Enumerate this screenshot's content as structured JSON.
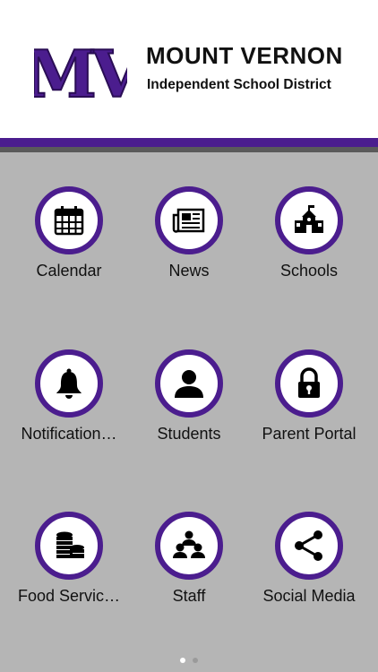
{
  "header": {
    "logo_text": "MV",
    "title": "MOUNT VERNON",
    "subtitle": "Independent School District"
  },
  "colors": {
    "brand_purple": "#4b1d8e",
    "background_gray": "#b5b5b5",
    "header_white": "#ffffff"
  },
  "tiles": [
    {
      "label": "Calendar",
      "icon": "calendar-icon"
    },
    {
      "label": "News",
      "icon": "newspaper-icon"
    },
    {
      "label": "Schools",
      "icon": "schoolhouse-icon"
    },
    {
      "label": "Notification…",
      "icon": "bell-icon"
    },
    {
      "label": "Students",
      "icon": "person-icon"
    },
    {
      "label": "Parent Portal",
      "icon": "padlock-icon"
    },
    {
      "label": "Food Servic…",
      "icon": "coin-stack-icon"
    },
    {
      "label": "Staff",
      "icon": "group-icon"
    },
    {
      "label": "Social Media",
      "icon": "share-icon"
    }
  ],
  "pager": {
    "pages": 2,
    "current": 1
  }
}
